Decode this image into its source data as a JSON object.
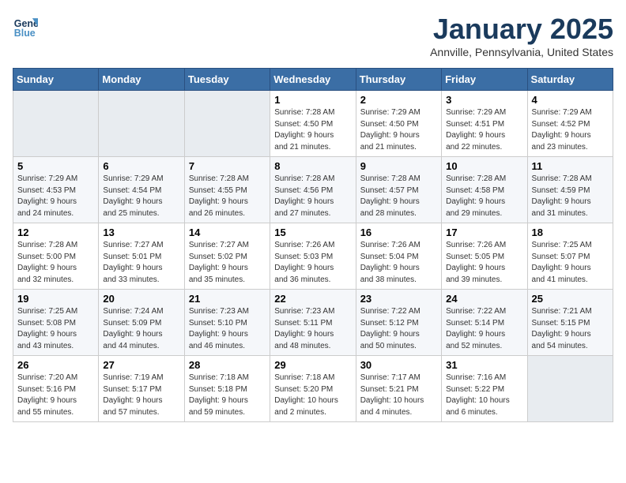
{
  "logo": {
    "line1": "General",
    "line2": "Blue"
  },
  "header": {
    "month": "January 2025",
    "location": "Annville, Pennsylvania, United States"
  },
  "weekdays": [
    "Sunday",
    "Monday",
    "Tuesday",
    "Wednesday",
    "Thursday",
    "Friday",
    "Saturday"
  ],
  "weeks": [
    [
      {
        "day": "",
        "info": ""
      },
      {
        "day": "",
        "info": ""
      },
      {
        "day": "",
        "info": ""
      },
      {
        "day": "1",
        "info": "Sunrise: 7:28 AM\nSunset: 4:50 PM\nDaylight: 9 hours\nand 21 minutes."
      },
      {
        "day": "2",
        "info": "Sunrise: 7:29 AM\nSunset: 4:50 PM\nDaylight: 9 hours\nand 21 minutes."
      },
      {
        "day": "3",
        "info": "Sunrise: 7:29 AM\nSunset: 4:51 PM\nDaylight: 9 hours\nand 22 minutes."
      },
      {
        "day": "4",
        "info": "Sunrise: 7:29 AM\nSunset: 4:52 PM\nDaylight: 9 hours\nand 23 minutes."
      }
    ],
    [
      {
        "day": "5",
        "info": "Sunrise: 7:29 AM\nSunset: 4:53 PM\nDaylight: 9 hours\nand 24 minutes."
      },
      {
        "day": "6",
        "info": "Sunrise: 7:29 AM\nSunset: 4:54 PM\nDaylight: 9 hours\nand 25 minutes."
      },
      {
        "day": "7",
        "info": "Sunrise: 7:28 AM\nSunset: 4:55 PM\nDaylight: 9 hours\nand 26 minutes."
      },
      {
        "day": "8",
        "info": "Sunrise: 7:28 AM\nSunset: 4:56 PM\nDaylight: 9 hours\nand 27 minutes."
      },
      {
        "day": "9",
        "info": "Sunrise: 7:28 AM\nSunset: 4:57 PM\nDaylight: 9 hours\nand 28 minutes."
      },
      {
        "day": "10",
        "info": "Sunrise: 7:28 AM\nSunset: 4:58 PM\nDaylight: 9 hours\nand 29 minutes."
      },
      {
        "day": "11",
        "info": "Sunrise: 7:28 AM\nSunset: 4:59 PM\nDaylight: 9 hours\nand 31 minutes."
      }
    ],
    [
      {
        "day": "12",
        "info": "Sunrise: 7:28 AM\nSunset: 5:00 PM\nDaylight: 9 hours\nand 32 minutes."
      },
      {
        "day": "13",
        "info": "Sunrise: 7:27 AM\nSunset: 5:01 PM\nDaylight: 9 hours\nand 33 minutes."
      },
      {
        "day": "14",
        "info": "Sunrise: 7:27 AM\nSunset: 5:02 PM\nDaylight: 9 hours\nand 35 minutes."
      },
      {
        "day": "15",
        "info": "Sunrise: 7:26 AM\nSunset: 5:03 PM\nDaylight: 9 hours\nand 36 minutes."
      },
      {
        "day": "16",
        "info": "Sunrise: 7:26 AM\nSunset: 5:04 PM\nDaylight: 9 hours\nand 38 minutes."
      },
      {
        "day": "17",
        "info": "Sunrise: 7:26 AM\nSunset: 5:05 PM\nDaylight: 9 hours\nand 39 minutes."
      },
      {
        "day": "18",
        "info": "Sunrise: 7:25 AM\nSunset: 5:07 PM\nDaylight: 9 hours\nand 41 minutes."
      }
    ],
    [
      {
        "day": "19",
        "info": "Sunrise: 7:25 AM\nSunset: 5:08 PM\nDaylight: 9 hours\nand 43 minutes."
      },
      {
        "day": "20",
        "info": "Sunrise: 7:24 AM\nSunset: 5:09 PM\nDaylight: 9 hours\nand 44 minutes."
      },
      {
        "day": "21",
        "info": "Sunrise: 7:23 AM\nSunset: 5:10 PM\nDaylight: 9 hours\nand 46 minutes."
      },
      {
        "day": "22",
        "info": "Sunrise: 7:23 AM\nSunset: 5:11 PM\nDaylight: 9 hours\nand 48 minutes."
      },
      {
        "day": "23",
        "info": "Sunrise: 7:22 AM\nSunset: 5:12 PM\nDaylight: 9 hours\nand 50 minutes."
      },
      {
        "day": "24",
        "info": "Sunrise: 7:22 AM\nSunset: 5:14 PM\nDaylight: 9 hours\nand 52 minutes."
      },
      {
        "day": "25",
        "info": "Sunrise: 7:21 AM\nSunset: 5:15 PM\nDaylight: 9 hours\nand 54 minutes."
      }
    ],
    [
      {
        "day": "26",
        "info": "Sunrise: 7:20 AM\nSunset: 5:16 PM\nDaylight: 9 hours\nand 55 minutes."
      },
      {
        "day": "27",
        "info": "Sunrise: 7:19 AM\nSunset: 5:17 PM\nDaylight: 9 hours\nand 57 minutes."
      },
      {
        "day": "28",
        "info": "Sunrise: 7:18 AM\nSunset: 5:18 PM\nDaylight: 9 hours\nand 59 minutes."
      },
      {
        "day": "29",
        "info": "Sunrise: 7:18 AM\nSunset: 5:20 PM\nDaylight: 10 hours\nand 2 minutes."
      },
      {
        "day": "30",
        "info": "Sunrise: 7:17 AM\nSunset: 5:21 PM\nDaylight: 10 hours\nand 4 minutes."
      },
      {
        "day": "31",
        "info": "Sunrise: 7:16 AM\nSunset: 5:22 PM\nDaylight: 10 hours\nand 6 minutes."
      },
      {
        "day": "",
        "info": ""
      }
    ]
  ]
}
